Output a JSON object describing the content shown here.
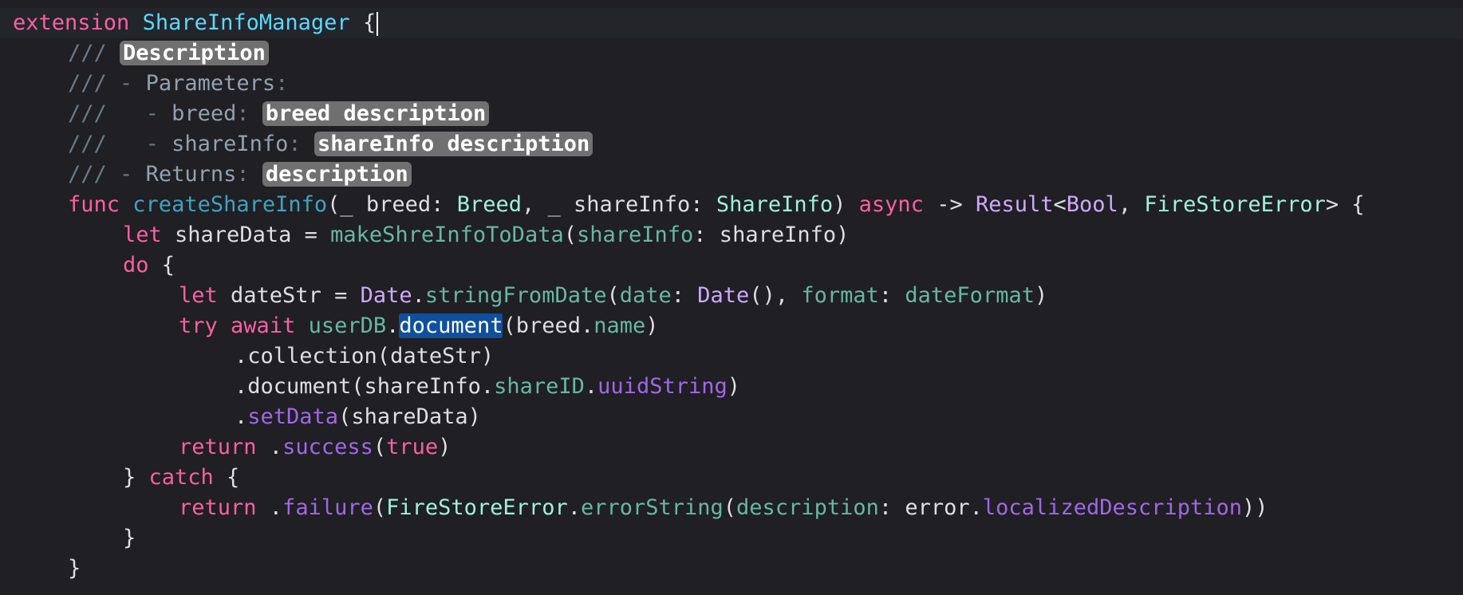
{
  "code": {
    "l1": {
      "kw": "extension",
      "type": "ShareInfoManager",
      "brace": "{"
    },
    "l2": {
      "slashes": "///",
      "placeholder": "Description"
    },
    "l3": {
      "slashes": "///",
      "dash": "-",
      "label": "Parameters",
      "colon": ":"
    },
    "l4": {
      "slashes": "///",
      "dash": "-",
      "label": "breed",
      "colon": ":",
      "placeholder": "breed description"
    },
    "l5": {
      "slashes": "///",
      "dash": "-",
      "label": "shareInfo",
      "colon": ":",
      "placeholder": "shareInfo description"
    },
    "l6": {
      "slashes": "///",
      "dash": "-",
      "label": "Returns",
      "colon": ":",
      "placeholder": "description"
    },
    "l7": {
      "kw_func": "func",
      "name": "createShareInfo",
      "p1": "(_ breed: ",
      "t1": "Breed",
      "p2": ", _ shareInfo: ",
      "t2": "ShareInfo",
      "p3": ") ",
      "kw_async": "async",
      "arrow": " -> ",
      "t3": "Result",
      "lt": "<",
      "t4": "Bool",
      "comma": ", ",
      "t5": "FireStoreError",
      "gt": "> {"
    },
    "l8": {
      "kw": "let",
      "p1": " shareData = ",
      "fn": "makeShreInfoToData",
      "p2": "(",
      "arg": "shareInfo",
      "p3": ": shareInfo)"
    },
    "l9": {
      "kw": "do",
      "p1": " {"
    },
    "l10": {
      "kw": "let",
      "p1": " dateStr = ",
      "t1": "Date",
      "dot": ".",
      "fn": "stringFromDate",
      "p2": "(",
      "a1": "date",
      "p3": ": ",
      "t2": "Date",
      "p4": "(), ",
      "a2": "format",
      "p5": ": ",
      "v": "dateFormat",
      "p6": ")"
    },
    "l11": {
      "kw1": "try",
      "kw2": "await",
      "v": "userDB",
      "dot": ".",
      "sel": "document",
      "p1": "(breed.",
      "prop": "name",
      "p2": ")"
    },
    "l12": {
      "text": ".collection(dateStr)"
    },
    "l13": {
      "p1": ".document(shareInfo.",
      "prop1": "shareID",
      "dot": ".",
      "prop2": "uuidString",
      "p2": ")"
    },
    "l14": {
      "dot": ".",
      "fn": "setData",
      "p1": "(shareData)"
    },
    "l15": {
      "kw": "return",
      "p1": " .",
      "fn": "success",
      "p2": "(",
      "lit": "true",
      "p3": ")"
    },
    "l16": {
      "p1": "} ",
      "kw": "catch",
      "p2": " {"
    },
    "l17": {
      "kw": "return",
      "p1": " .",
      "fn": "failure",
      "p2": "(",
      "t1": "FireStoreError",
      "dot": ".",
      "fn2": "errorString",
      "p3": "(",
      "a1": "description",
      "p4": ": error.",
      "prop": "localizedDescription",
      "p5": "))"
    },
    "l18": {
      "text": "}"
    },
    "l19": {
      "text": "}"
    }
  },
  "colors": {
    "background": "#1f1f24",
    "keyword": "#fc5fa3",
    "type": "#5dd8ff",
    "project_type": "#9ef1dd",
    "system_type": "#d0a8ff",
    "function": "#67b7a4",
    "system_member": "#a167e6",
    "comment": "#6c7986",
    "placeholder_bg": "#707070",
    "selection_bg": "#0f4f9e"
  }
}
